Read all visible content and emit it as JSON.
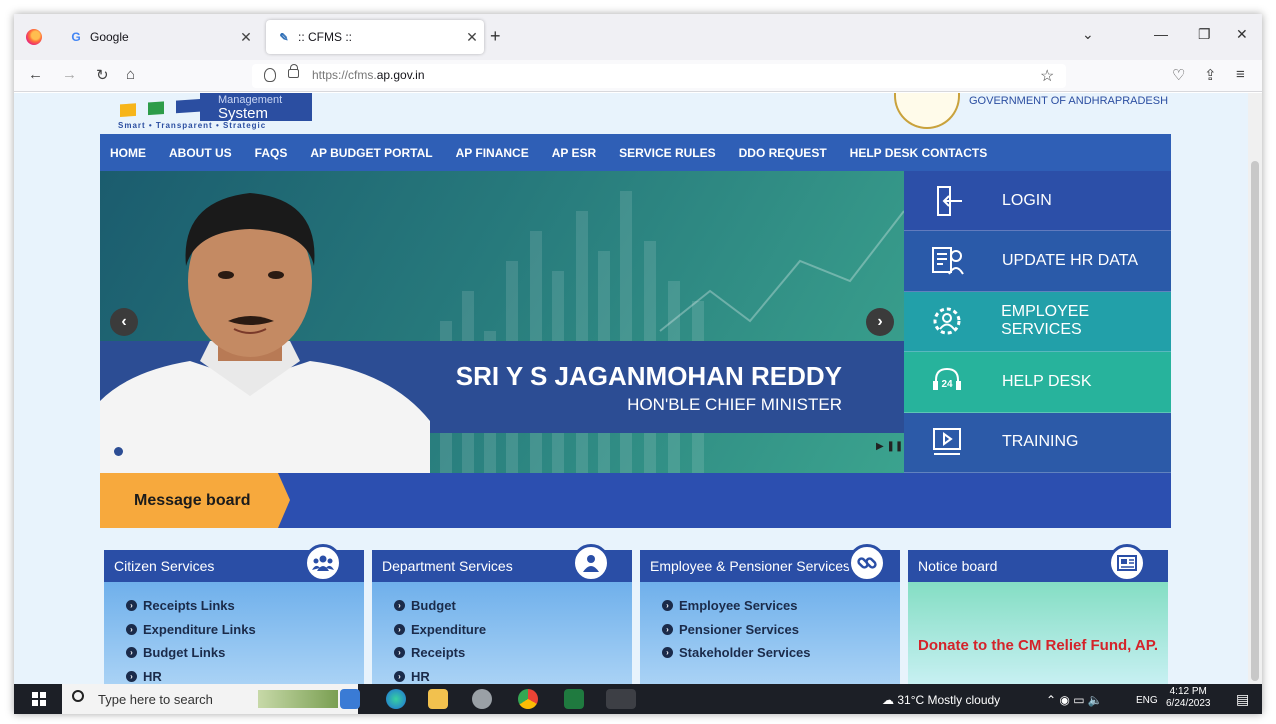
{
  "browser": {
    "tabs": [
      {
        "label": "Google",
        "icon": "google-g-icon"
      },
      {
        "label": ":: CFMS ::",
        "icon": "cfms-favicon"
      }
    ],
    "url_prefix": "https://cfms.",
    "url_domain": "ap.gov.in"
  },
  "header": {
    "logo_top": "Management",
    "logo_system": "System",
    "logo_tagline": "Smart • Transparent • Strategic",
    "gov_text": "GOVERNMENT OF ANDHRAPRADESH"
  },
  "nav": [
    "HOME",
    "ABOUT US",
    "FAQS",
    "AP BUDGET PORTAL",
    "AP FINANCE",
    "AP ESR",
    "SERVICE RULES",
    "DDO REQUEST",
    "HELP DESK CONTACTS"
  ],
  "banner": {
    "name": "SRI Y S JAGANMOHAN REDDY",
    "designation": "HON'BLE CHIEF MINISTER"
  },
  "side_menu": [
    {
      "label": "LOGIN",
      "color": "#2c4fa8",
      "icon": "login-door-icon"
    },
    {
      "label": "UPDATE HR DATA",
      "color": "#2a5aa9",
      "icon": "hr-data-icon"
    },
    {
      "label": "EMPLOYEE SERVICES",
      "color": "#22a0a9",
      "icon": "employee-gear-icon"
    },
    {
      "label": "HELP DESK",
      "color": "#27b39c",
      "icon": "helpdesk-24-icon"
    },
    {
      "label": "TRAINING",
      "color": "#2c5aa8",
      "icon": "training-screen-icon"
    }
  ],
  "message_board": {
    "label": "Message board"
  },
  "cards": {
    "citizen": {
      "title": "Citizen Services",
      "items": [
        "Receipts Links",
        "Expenditure Links",
        "Budget Links",
        "HR"
      ]
    },
    "department": {
      "title": "Department Services",
      "items": [
        "Budget",
        "Expenditure",
        "Receipts",
        "HR"
      ]
    },
    "employee": {
      "title": "Employee & Pensioner Services",
      "items": [
        "Employee Services",
        "Pensioner Services",
        "Stakeholder Services"
      ]
    },
    "notice": {
      "title": "Notice board",
      "text": "Donate to the CM Relief Fund, AP."
    }
  },
  "taskbar": {
    "search_placeholder": "Type here to search",
    "weather": "31°C  Mostly cloudy",
    "lang": "ENG",
    "time": "4:12 PM",
    "date": "6/24/2023"
  }
}
